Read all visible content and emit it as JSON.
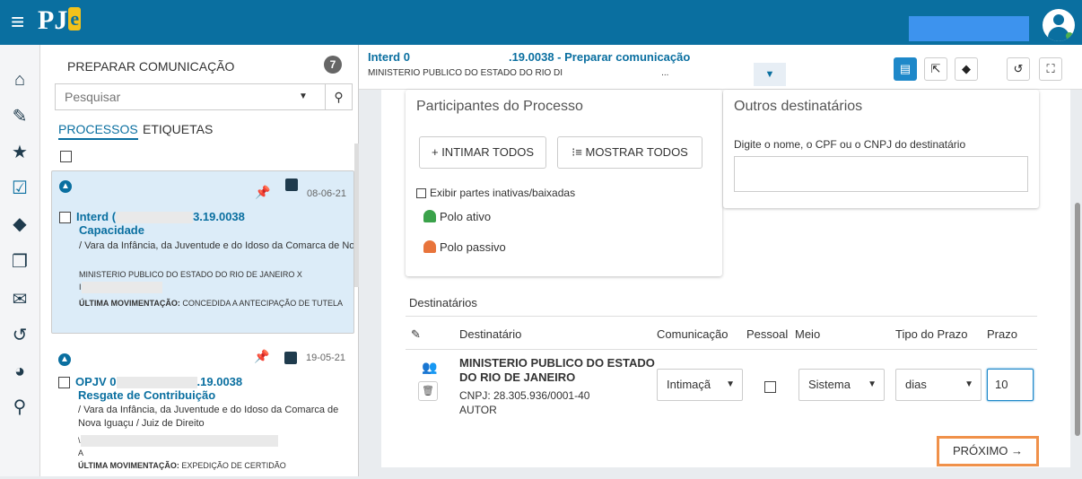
{
  "app": {
    "brand_main": "PJ",
    "brand_e": "e"
  },
  "colors": {
    "topbar": "#0a6fa0",
    "accent": "#1e88c9",
    "highlight": "#f0914a"
  },
  "nav_icons": [
    "home-icon",
    "pencil-icon",
    "star-icon",
    "checkbox-icon",
    "tags-icon",
    "copy-icon",
    "mail-icon",
    "history-icon",
    "pie-chart-icon",
    "search-icon"
  ],
  "list": {
    "title": "PREPARAR COMUNICAÇÃO",
    "count": "7",
    "search_placeholder": "Pesquisar",
    "tabs": [
      "PROCESSOS",
      "ETIQUETAS"
    ],
    "cards": [
      {
        "date": "08-06-21",
        "num_a": "Interd (",
        "num_b": "3.19.0038",
        "classe": "Capacidade",
        "desc": "/ Vara da Infância, da Juventude e do Idoso da Comarca de Nova Iguaçu / Juiz de Direito",
        "parte": "MINISTERIO PUBLICO DO ESTADO DO RIO DE JANEIRO X",
        "parte2": "I",
        "mov_label": "ÚLTIMA MOVIMENTAÇÃO:",
        "mov_text": "CONCEDIDA A ANTECIPAÇÃO DE TUTELA"
      },
      {
        "date": "19-05-21",
        "num_a": "OPJV 0",
        "num_b": ".19.0038",
        "classe": "Resgate de Contribuição",
        "desc": "/ Vara da Infância, da Juventude e do Idoso da Comarca de Nova Iguaçu / Juiz de Direito",
        "parte": "\\",
        "parte2": "A",
        "mov_label": "ÚLTIMA MOVIMENTAÇÃO:",
        "mov_text": "EXPEDIÇÃO DE CERTIDÃO"
      }
    ]
  },
  "header": {
    "title_a": "Interd 0",
    "title_b": ".19.0038 - Preparar comunicação",
    "subtitle": "MINISTERIO PUBLICO DO ESTADO DO RIO DI",
    "subtitle_b": "..."
  },
  "participantes": {
    "title": "Participantes do Processo",
    "btn_intimar": "+ INTIMAR TODOS",
    "btn_mostrar": "MOSTRAR TODOS",
    "exibir": "Exibir partes inativas/baixadas",
    "polo_ativo": "Polo ativo",
    "polo_passivo": "Polo passivo"
  },
  "outros": {
    "title": "Outros destinatários",
    "label": "Digite o nome, o CPF ou o CNPJ do destinatário"
  },
  "destinatarios": {
    "title": "Destinatários",
    "columns": [
      "Destinatário",
      "Comunicação",
      "Pessoal",
      "Meio",
      "Tipo do Prazo",
      "Prazo"
    ],
    "row": {
      "name": "MINISTERIO PUBLICO DO ESTADO DO RIO DE JANEIRO",
      "cnpj": "CNPJ: 28.305.936/0001-40",
      "role": "AUTOR",
      "comunicacao": "Intimaçã",
      "meio": "Sistema",
      "tipo_prazo": "dias",
      "prazo": "10"
    }
  },
  "proximo": "PRÓXIMO →"
}
